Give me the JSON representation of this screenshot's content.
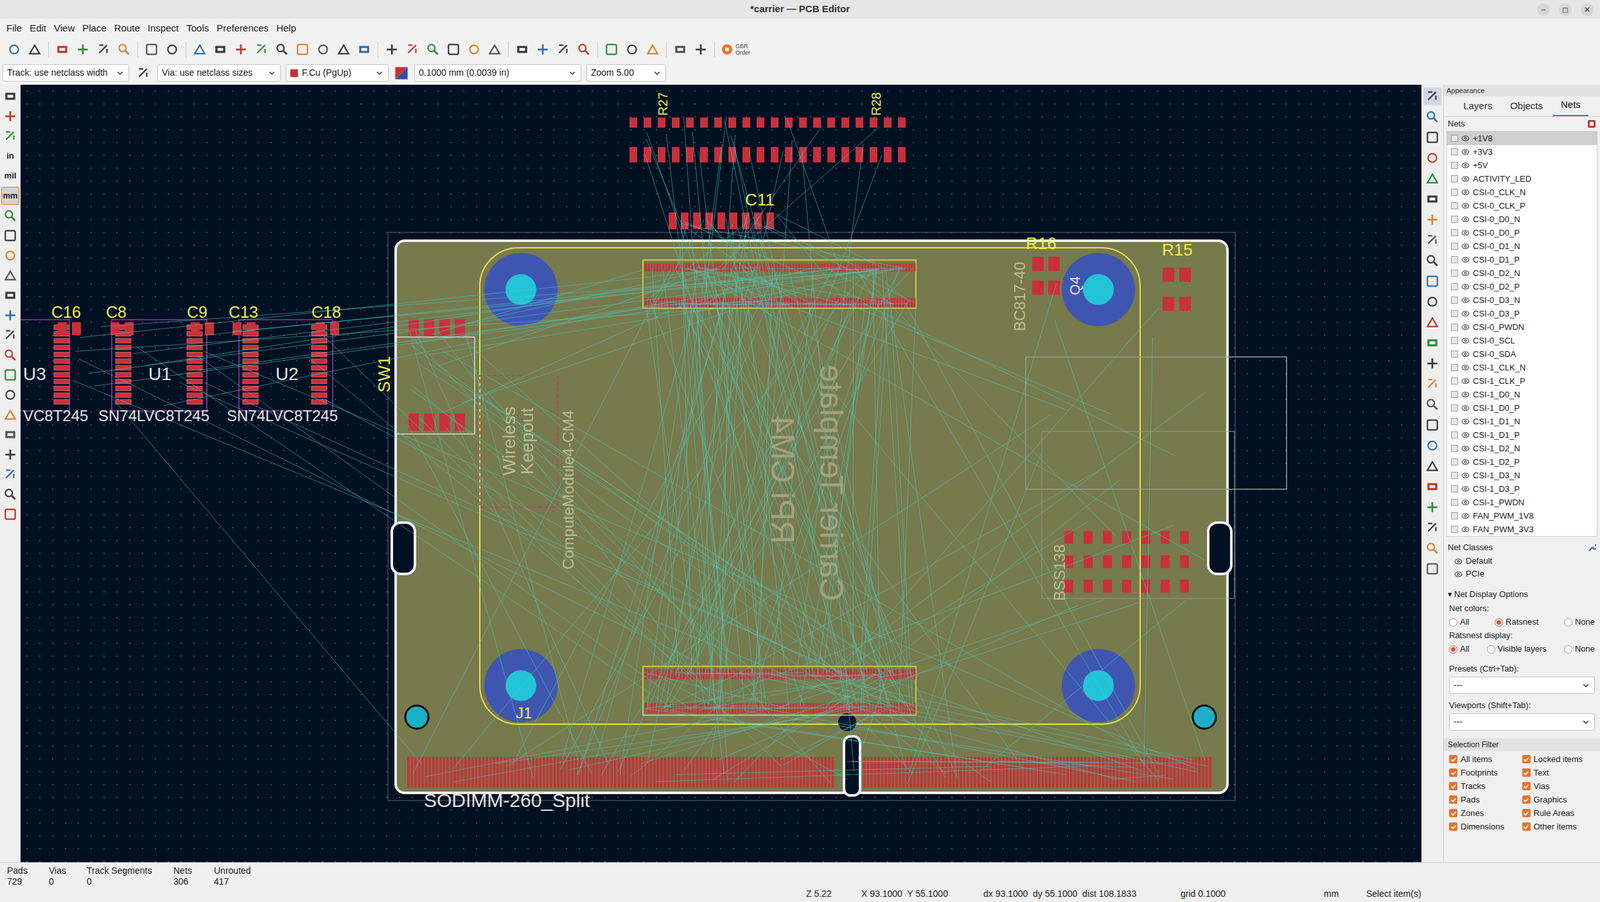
{
  "window": {
    "title": "*carrier — PCB Editor",
    "controls": [
      "–",
      "◻",
      "✕"
    ]
  },
  "menu": [
    "File",
    "Edit",
    "View",
    "Place",
    "Route",
    "Inspect",
    "Tools",
    "Preferences",
    "Help"
  ],
  "toolbar": {
    "gbr": "GBR",
    "order": "Order"
  },
  "options_bar": {
    "track": "Track: use netclass width",
    "via": "Via: use netclass sizes",
    "layer": "F.Cu (PgUp)",
    "layer_color": "#c83434",
    "grid": "0.1000 mm (0.0039 in)",
    "zoom": "Zoom 5.00"
  },
  "left_toolbar": {
    "units": [
      {
        "label": "in",
        "selected": false
      },
      {
        "label": "mil",
        "selected": false
      },
      {
        "label": "mm",
        "selected": true
      }
    ]
  },
  "canvas": {
    "labels": [
      {
        "text": "C16",
        "kind": "ref"
      },
      {
        "text": "C8",
        "kind": "ref"
      },
      {
        "text": "C9",
        "kind": "ref"
      },
      {
        "text": "C13",
        "kind": "ref"
      },
      {
        "text": "C18",
        "kind": "ref"
      },
      {
        "text": "U3",
        "kind": "value"
      },
      {
        "text": "U1",
        "kind": "value"
      },
      {
        "text": "U2",
        "kind": "value"
      },
      {
        "text": "VC8T245",
        "kind": "value"
      },
      {
        "text": "SN74LVC8T245",
        "kind": "value"
      },
      {
        "text": "SN74LVC8T245",
        "kind": "value"
      },
      {
        "text": "C11",
        "kind": "ref"
      },
      {
        "text": "R16",
        "kind": "ref"
      },
      {
        "text": "R15",
        "kind": "ref"
      },
      {
        "text": "J1",
        "kind": "ref"
      },
      {
        "text": "SODIMM-260_Split",
        "kind": "value"
      },
      {
        "text": "SW1",
        "kind": "ref"
      },
      {
        "text": "Q4",
        "kind": "value"
      },
      {
        "text": "BC817-40",
        "kind": "fab"
      },
      {
        "text": "Wireless Keepout",
        "kind": "fab"
      },
      {
        "text": "ComputeModule4-CM4",
        "kind": "fab"
      },
      {
        "text": "Carrier Template",
        "kind": "big"
      },
      {
        "text": "RPi CM4",
        "kind": "big"
      },
      {
        "text": "BSS138",
        "kind": "fab"
      },
      {
        "text": "R27",
        "kind": "ref"
      },
      {
        "text": "R28",
        "kind": "ref"
      }
    ]
  },
  "appearance": {
    "title": "Appearance",
    "tabs": [
      {
        "label": "Layers",
        "selected": false
      },
      {
        "label": "Objects",
        "selected": false
      },
      {
        "label": "Nets",
        "selected": true
      }
    ],
    "nets_label": "Nets",
    "nets": [
      {
        "name": "+1V8",
        "selected": true
      },
      {
        "name": "+3V3",
        "selected": false
      },
      {
        "name": "+5V",
        "selected": false
      },
      {
        "name": "ACTIVITY_LED",
        "selected": false
      },
      {
        "name": "CSI-0_CLK_N",
        "selected": false
      },
      {
        "name": "CSI-0_CLK_P",
        "selected": false
      },
      {
        "name": "CSI-0_D0_N",
        "selected": false
      },
      {
        "name": "CSI-0_D0_P",
        "selected": false
      },
      {
        "name": "CSI-0_D1_N",
        "selected": false
      },
      {
        "name": "CSI-0_D1_P",
        "selected": false
      },
      {
        "name": "CSI-0_D2_N",
        "selected": false
      },
      {
        "name": "CSI-0_D2_P",
        "selected": false
      },
      {
        "name": "CSI-0_D3_N",
        "selected": false
      },
      {
        "name": "CSI-0_D3_P",
        "selected": false
      },
      {
        "name": "CSI-0_PWDN",
        "selected": false
      },
      {
        "name": "CSI-0_SCL",
        "selected": false
      },
      {
        "name": "CSI-0_SDA",
        "selected": false
      },
      {
        "name": "CSI-1_CLK_N",
        "selected": false
      },
      {
        "name": "CSI-1_CLK_P",
        "selected": false
      },
      {
        "name": "CSI-1_D0_N",
        "selected": false
      },
      {
        "name": "CSI-1_D0_P",
        "selected": false
      },
      {
        "name": "CSI-1_D1_N",
        "selected": false
      },
      {
        "name": "CSI-1_D1_P",
        "selected": false
      },
      {
        "name": "CSI-1_D2_N",
        "selected": false
      },
      {
        "name": "CSI-1_D2_P",
        "selected": false
      },
      {
        "name": "CSI-1_D3_N",
        "selected": false
      },
      {
        "name": "CSI-1_D3_P",
        "selected": false
      },
      {
        "name": "CSI-1_PWDN",
        "selected": false
      },
      {
        "name": "FAN_PWM_1V8",
        "selected": false
      },
      {
        "name": "FAN_PWM_3V3",
        "selected": false
      }
    ],
    "net_classes": {
      "title": "Net Classes",
      "items": [
        "Default",
        "PCIe"
      ]
    },
    "display_options": {
      "collapse_icon": "▾",
      "title": "Net Display Options",
      "net_colors": {
        "label": "Net colors:",
        "options": [
          {
            "label": "All",
            "selected": false
          },
          {
            "label": "Ratsnest",
            "selected": true
          },
          {
            "label": "None",
            "selected": false
          }
        ]
      },
      "ratsnest_display": {
        "label": "Ratsnest display:",
        "options": [
          {
            "label": "All",
            "selected": true
          },
          {
            "label": "Visible layers",
            "selected": false
          },
          {
            "label": "None",
            "selected": false
          }
        ]
      }
    },
    "presets": {
      "label": "Presets (Ctrl+Tab):",
      "value": "---"
    },
    "viewports": {
      "label": "Viewports (Shift+Tab):",
      "value": "---"
    },
    "selection_filter": {
      "title": "Selection Filter",
      "items": [
        {
          "label": "All items",
          "checked": true
        },
        {
          "label": "Locked items",
          "checked": true
        },
        {
          "label": "Footprints",
          "checked": true
        },
        {
          "label": "Text",
          "checked": true
        },
        {
          "label": "Tracks",
          "checked": true
        },
        {
          "label": "Vias",
          "checked": true
        },
        {
          "label": "Pads",
          "checked": true
        },
        {
          "label": "Graphics",
          "checked": true
        },
        {
          "label": "Zones",
          "checked": true
        },
        {
          "label": "Rule Areas",
          "checked": true
        },
        {
          "label": "Dimensions",
          "checked": true
        },
        {
          "label": "Other items",
          "checked": true
        }
      ]
    }
  },
  "status": {
    "counts": [
      {
        "label": "Pads",
        "value": "729"
      },
      {
        "label": "Vias",
        "value": "0"
      },
      {
        "label": "Track Segments",
        "value": "0"
      },
      {
        "label": "Nets",
        "value": "306"
      },
      {
        "label": "Unrouted",
        "value": "417"
      }
    ],
    "zoom": "Z 5.22",
    "xy": "X 93.1000  Y 55.1000",
    "delta": "dx 93.1000  dy 55.1000  dist 108.1833",
    "grid": "grid 0.1000",
    "units": "mm",
    "mode": "Select item(s)"
  }
}
